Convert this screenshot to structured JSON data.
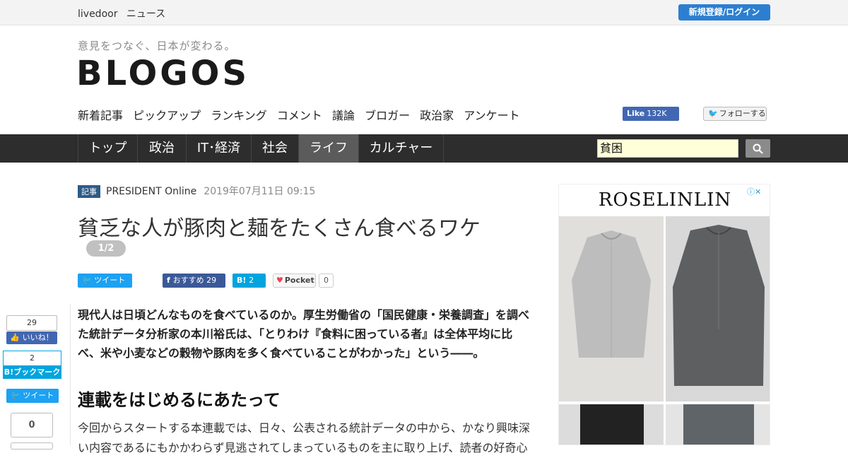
{
  "topbar": {
    "brand": "livedoor",
    "section": "ニュース",
    "login_label": "新規登録/ログイン"
  },
  "site": {
    "tagline": "意見をつなぐ、日本が変わる。",
    "logo": "BLOGOS"
  },
  "subnav": [
    "新着記事",
    "ピックアップ",
    "ランキング",
    "コメント",
    "議論",
    "ブロガー",
    "政治家",
    "アンケート"
  ],
  "social_header": {
    "fb_like_label": "Like",
    "fb_like_count": "132K",
    "tw_follow_label": "フォローする"
  },
  "mainnav": {
    "items": [
      "トップ",
      "政治",
      "IT･経済",
      "社会",
      "ライフ",
      "カルチャー"
    ],
    "active_index": 4
  },
  "search": {
    "value": "貧困"
  },
  "article": {
    "category": "記事",
    "source": "PRESIDENT Online",
    "date": "2019年07月11日 09:15",
    "title": "貧乏な人が豚肉と麺をたくさん食べるワケ",
    "page_indicator": "1/2",
    "share": {
      "tweet": "ツイート",
      "fb_recommend": "おすすめ",
      "fb_count": "29",
      "hatena_label": "B!",
      "hatena_count": "2",
      "pocket_label": "Pocket",
      "pocket_count": "0"
    },
    "lede": "現代人は日頃どんなものを食べているのか。厚生労働省の「国民健康・栄養調査」を調べた統計データ分析家の本川裕氏は、「とりわけ『食料に困っている者』は全体平均に比べ、米や小麦などの穀物や豚肉を多く食べていることがわかった」という――。",
    "heading": "連載をはじめるにあたって",
    "body": "今回からスタートする本連載では、日々、公表される統計データの中から、かなり興味深い内容であるにもかかわらず見逃されてしまっているものを主に取り上げ、読者の好奇心"
  },
  "side_share": {
    "like_count": "29",
    "like_label": "いいね！",
    "hatena_count": "2",
    "hatena_label": "B!ブックマーク",
    "tweet_label": "ツイート",
    "pocket_count": "0"
  },
  "ad": {
    "brand": "ROSELINLIN"
  },
  "colors": {
    "nav_bg": "#2d2d2d",
    "nav_active": "#5b5b5b",
    "login": "#2c7fd0",
    "facebook": "#3b5998",
    "twitter": "#1da1f2",
    "hatena": "#00a4de"
  }
}
